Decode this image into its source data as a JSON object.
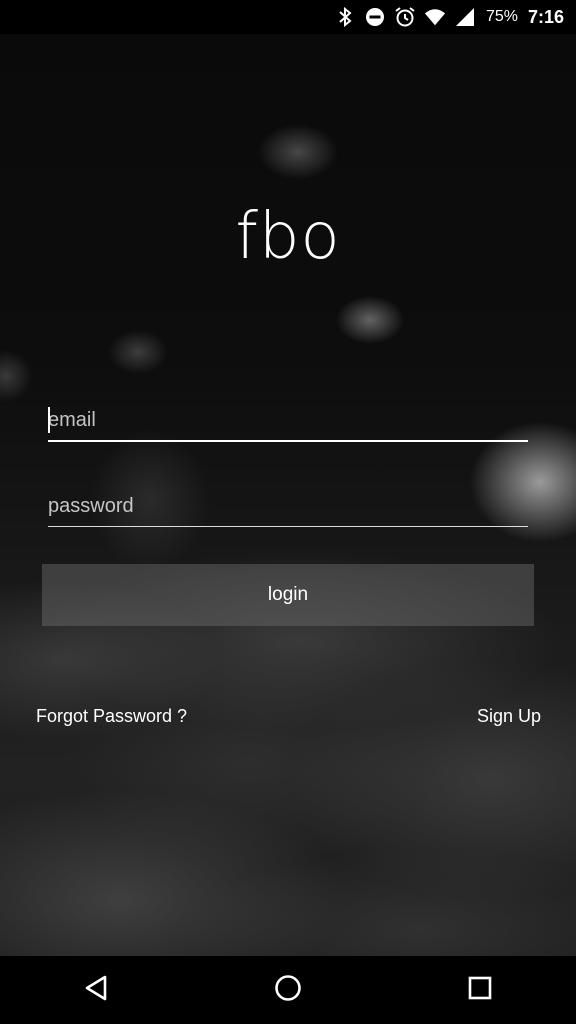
{
  "status_bar": {
    "icons": [
      "bluetooth-icon",
      "do-not-disturb-icon",
      "alarm-icon",
      "wifi-icon",
      "cellular-signal-icon"
    ],
    "battery_percent": "75%",
    "time": "7:16"
  },
  "app": {
    "logo_text": "fbo"
  },
  "form": {
    "email_placeholder": "email",
    "email_value": "",
    "password_placeholder": "password",
    "password_value": "",
    "login_label": "login"
  },
  "links": {
    "forgot_password": "Forgot Password ?",
    "sign_up": "Sign Up"
  },
  "nav_bar": {
    "buttons": [
      "back-icon",
      "home-icon",
      "recents-icon"
    ]
  },
  "colors": {
    "text": "#ffffff",
    "button_bg": "#6e6e6e"
  }
}
